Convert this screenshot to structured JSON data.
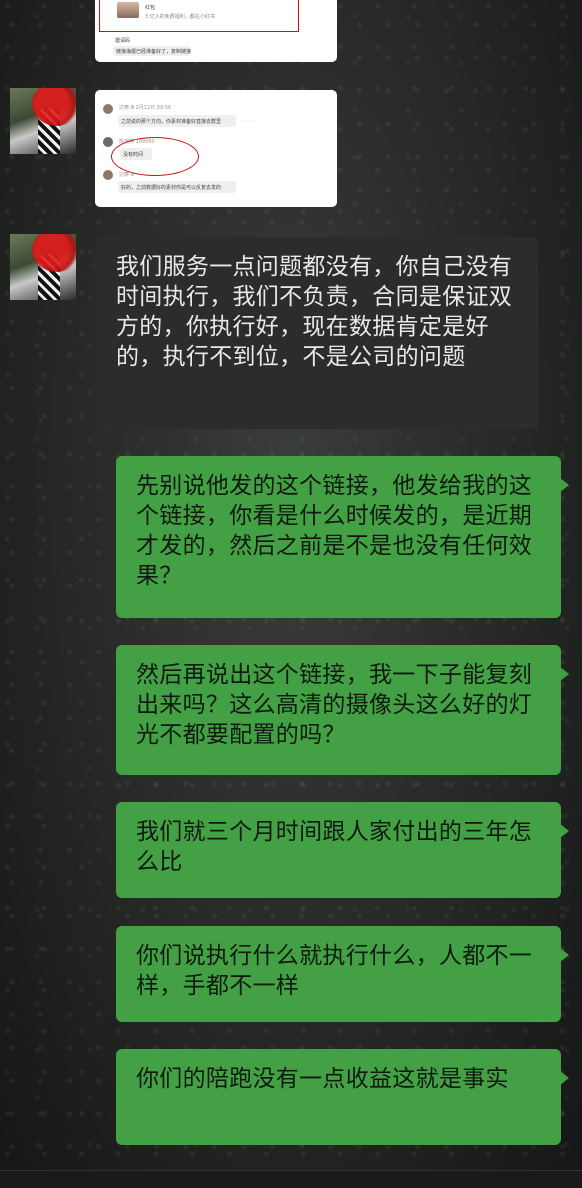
{
  "screenshot_top": {
    "card_title": "红包",
    "card_sub": "3 亿人的免费福利，都在小红书",
    "footer_line1": "邀请码",
    "footer_line2": "链接海报已经准备好了，复制链接"
  },
  "screenshot_mid": {
    "sender_meta": "达摩·Ⅲ 2月12日 09:56",
    "msg1": "之前说的那个方向，你素材准备好直接去群里",
    "reply_sender": "陈雨婷·109560",
    "msg2": "没有时间",
    "sender3": "达摩·Ⅲ",
    "msg3": "好的，之前数据好的素材你是可以反复去发的"
  },
  "messages": [
    {
      "side": "left",
      "text": "我们服务一点问题都没有，你自己没有时间执行，我们不负责，合同是保证双方的，你执行好，现在数据肯定是好的，执行不到位，不是公司的问题"
    },
    {
      "side": "right",
      "text": "先别说他发的这个链接，他发给我的这个链接，你看是什么时候发的，是近期才发的，然后之前是不是也没有任何效果？"
    },
    {
      "side": "right",
      "text": "然后再说出这个链接，我一下子能复刻出来吗？这么高清的摄像头这么好的灯光不都要配置的吗？"
    },
    {
      "side": "right",
      "text": "我们就三个月时间跟人家付出的三年怎么比"
    },
    {
      "side": "right",
      "text": "你们说执行什么就执行什么，人都不一样，手都不一样"
    },
    {
      "side": "right",
      "text": "你们的陪跑没有一点收益这就是事实"
    }
  ],
  "colors": {
    "bubble_right": "#44a045",
    "bubble_left": "#2c2c2c",
    "annotation_red": "#cc1111"
  }
}
